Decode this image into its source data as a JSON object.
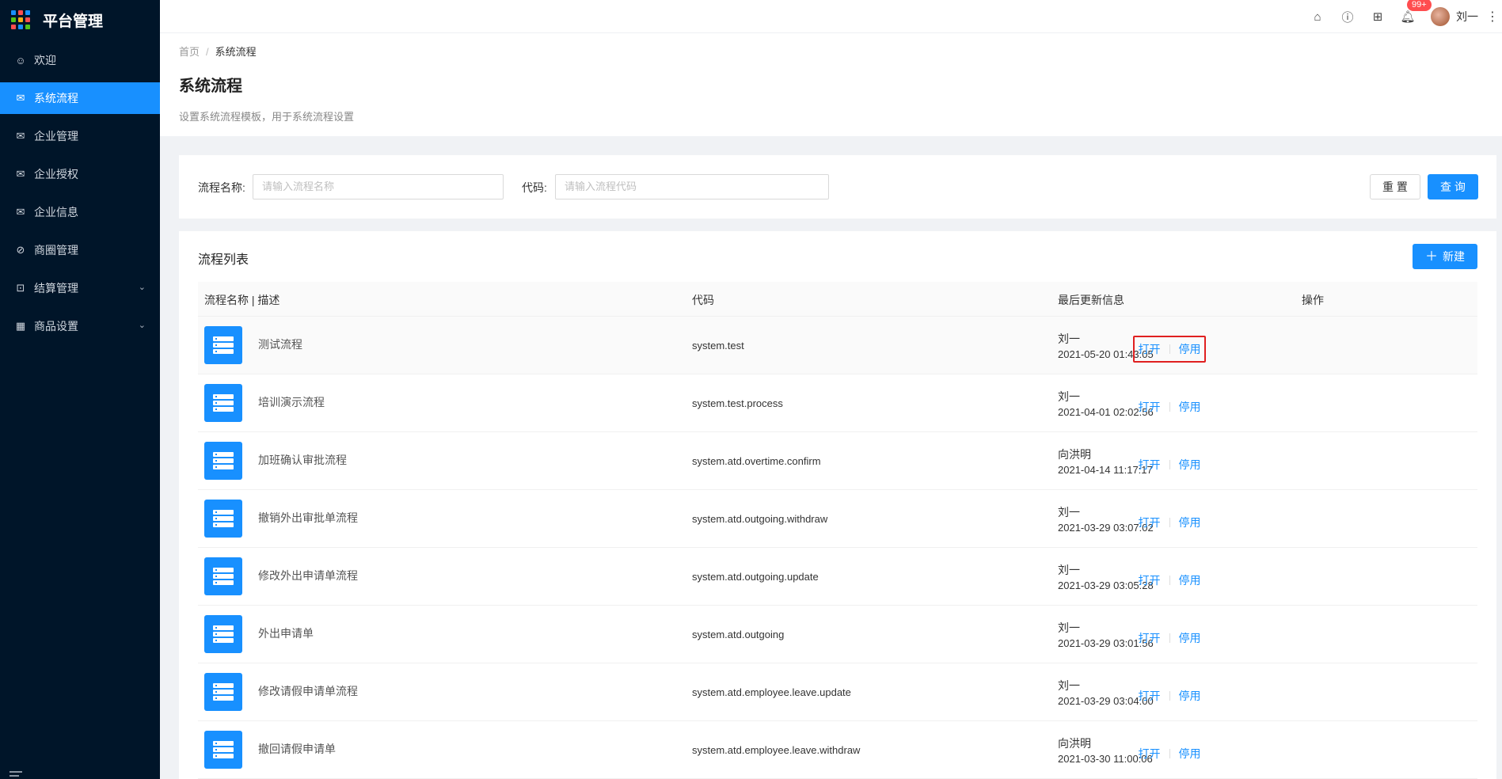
{
  "sidebar": {
    "title": "平台管理",
    "items": [
      {
        "label": "欢迎",
        "icon": "smile-icon",
        "glyph": "☺",
        "active": false,
        "expandable": false
      },
      {
        "label": "系统流程",
        "icon": "mail-icon",
        "glyph": "✉",
        "active": true,
        "expandable": false
      },
      {
        "label": "企业管理",
        "icon": "mail-icon",
        "glyph": "✉",
        "active": false,
        "expandable": false
      },
      {
        "label": "企业授权",
        "icon": "mail-icon",
        "glyph": "✉",
        "active": false,
        "expandable": false
      },
      {
        "label": "企业信息",
        "icon": "mail-icon",
        "glyph": "✉",
        "active": false,
        "expandable": false
      },
      {
        "label": "商圈管理",
        "icon": "compass-icon",
        "glyph": "⊘",
        "active": false,
        "expandable": false
      },
      {
        "label": "结算管理",
        "icon": "calculator-icon",
        "glyph": "⊡",
        "active": false,
        "expandable": true
      },
      {
        "label": "商品设置",
        "icon": "appstore-icon",
        "glyph": "▦",
        "active": false,
        "expandable": true
      }
    ]
  },
  "topbar": {
    "notification_count": "99+",
    "username": "刘一"
  },
  "breadcrumb": {
    "home": "首页",
    "current": "系统流程"
  },
  "page": {
    "title": "系统流程",
    "description": "设置系统流程模板，用于系统流程设置"
  },
  "filter": {
    "name_label": "流程名称:",
    "name_placeholder": "请输入流程名称",
    "code_label": "代码:",
    "code_placeholder": "请输入流程代码",
    "reset_label": "重 置",
    "search_label": "查 询"
  },
  "list": {
    "title": "流程列表",
    "new_label": "新建",
    "columns": [
      "流程名称 | 描述",
      "代码",
      "最后更新信息",
      "操作"
    ],
    "open_label": "打开",
    "disable_label": "停用",
    "rows": [
      {
        "name": "测试流程",
        "code": "system.test",
        "user": "刘一",
        "time": "2021-05-20 01:43:05"
      },
      {
        "name": "培训演示流程",
        "code": "system.test.process",
        "user": "刘一",
        "time": "2021-04-01 02:02:56"
      },
      {
        "name": "加班确认审批流程",
        "code": "system.atd.overtime.confirm",
        "user": "向洪明",
        "time": "2021-04-14 11:17:17"
      },
      {
        "name": "撤销外出审批单流程",
        "code": "system.atd.outgoing.withdraw",
        "user": "刘一",
        "time": "2021-03-29 03:07:02"
      },
      {
        "name": "修改外出申请单流程",
        "code": "system.atd.outgoing.update",
        "user": "刘一",
        "time": "2021-03-29 03:05:28"
      },
      {
        "name": "外出申请单",
        "code": "system.atd.outgoing",
        "user": "刘一",
        "time": "2021-03-29 03:01:56"
      },
      {
        "name": "修改请假申请单流程",
        "code": "system.atd.employee.leave.update",
        "user": "刘一",
        "time": "2021-03-29 03:04:00"
      },
      {
        "name": "撤回请假申请单",
        "code": "system.atd.employee.leave.withdraw",
        "user": "向洪明",
        "time": "2021-03-30 11:00:06"
      }
    ]
  },
  "colors": {
    "primary": "#1890ff",
    "sidebar_bg": "#001529",
    "highlight": "#e02020",
    "badge": "#ff4d4f"
  }
}
